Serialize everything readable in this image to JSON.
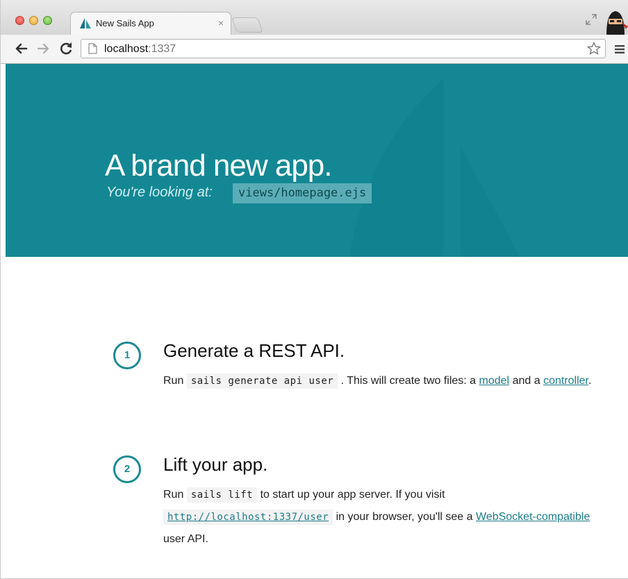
{
  "browser": {
    "tab_title": "New Sails App",
    "tab_close": "×",
    "url_host": "localhost",
    "url_port": ":1337"
  },
  "hero": {
    "title": "A brand new app.",
    "subtitle": "You're looking at:",
    "file": "views/homepage.ejs",
    "background_color": "#138894"
  },
  "steps": [
    {
      "number": "1",
      "title": "Generate a REST API.",
      "run": "Run",
      "command": "sails generate api user",
      "text1": ". This will create two files: a",
      "link1": "model",
      "text2": "and a",
      "link2": "controller",
      "text3": "."
    },
    {
      "number": "2",
      "title": "Lift your app.",
      "run": "Run",
      "command": "sails lift",
      "text1": "to start up your app server. If you visit",
      "url": "http://localhost:1337/user",
      "text2": "in your browser, you'll see a",
      "link1": "WebSocket-compatible",
      "text3": "user API."
    }
  ],
  "colors": {
    "accent": "#1d8a96",
    "link": "#1c7c8a"
  }
}
